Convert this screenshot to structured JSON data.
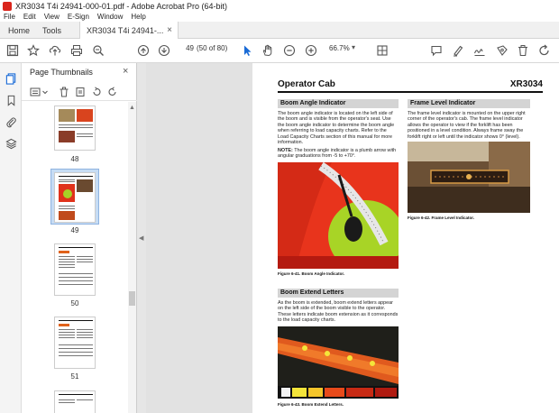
{
  "window": {
    "title": "XR3034 T4i 24941-000-01.pdf - Adobe Acrobat Pro (64-bit)"
  },
  "menu": [
    "File",
    "Edit",
    "View",
    "E-Sign",
    "Window",
    "Help"
  ],
  "tabs": {
    "home": "Home",
    "tools": "Tools",
    "doc": "XR3034 T4i 24941-...",
    "close": "×"
  },
  "toolbar": {
    "page_number": "49",
    "page_of": "(50 of 80)",
    "zoom": "66.7%",
    "zoom_caret": "▾"
  },
  "thumbnails_panel": {
    "title": "Page Thumbnails",
    "close": "×",
    "labels": [
      "48",
      "49",
      "50",
      "51"
    ]
  },
  "page": {
    "section_title": "Operator Cab",
    "model": "XR3034",
    "boom_angle": {
      "heading": "Boom Angle Indicator",
      "text": "The boom angle indicator is located on the left side of the boom and is visible from the operator's seat. Use the boom angle indicator to determine the boom angle when referring to load capacity charts. Refer to the Load Capacity Charts section of this manual for more information.",
      "note_label": "NOTE:",
      "note_text": "The boom angle indicator is a plumb arrow with angular graduations from -5 to +70°.",
      "caption": "Figure 6-41. Boom Angle Indicator."
    },
    "frame_level": {
      "heading": "Frame Level Indicator",
      "text": "The frame level indicator is mounted on the upper right corner of the operator's cab. The frame level indicator allows the operator to view if the forklift has been positioned in a level condition. Always frame sway the forklift right or left until the indicator shows 0° (level).",
      "caption": "Figure 6-42. Frame Level Indicator."
    },
    "boom_extend": {
      "heading": "Boom Extend Letters",
      "text": "As the boom is extended, boom extend letters appear on the left side of the boom visible to the operator. These letters indicate boom extension as it corresponds to the load capacity charts.",
      "caption": "Figure 6-43. Boom Extend Letters."
    }
  }
}
